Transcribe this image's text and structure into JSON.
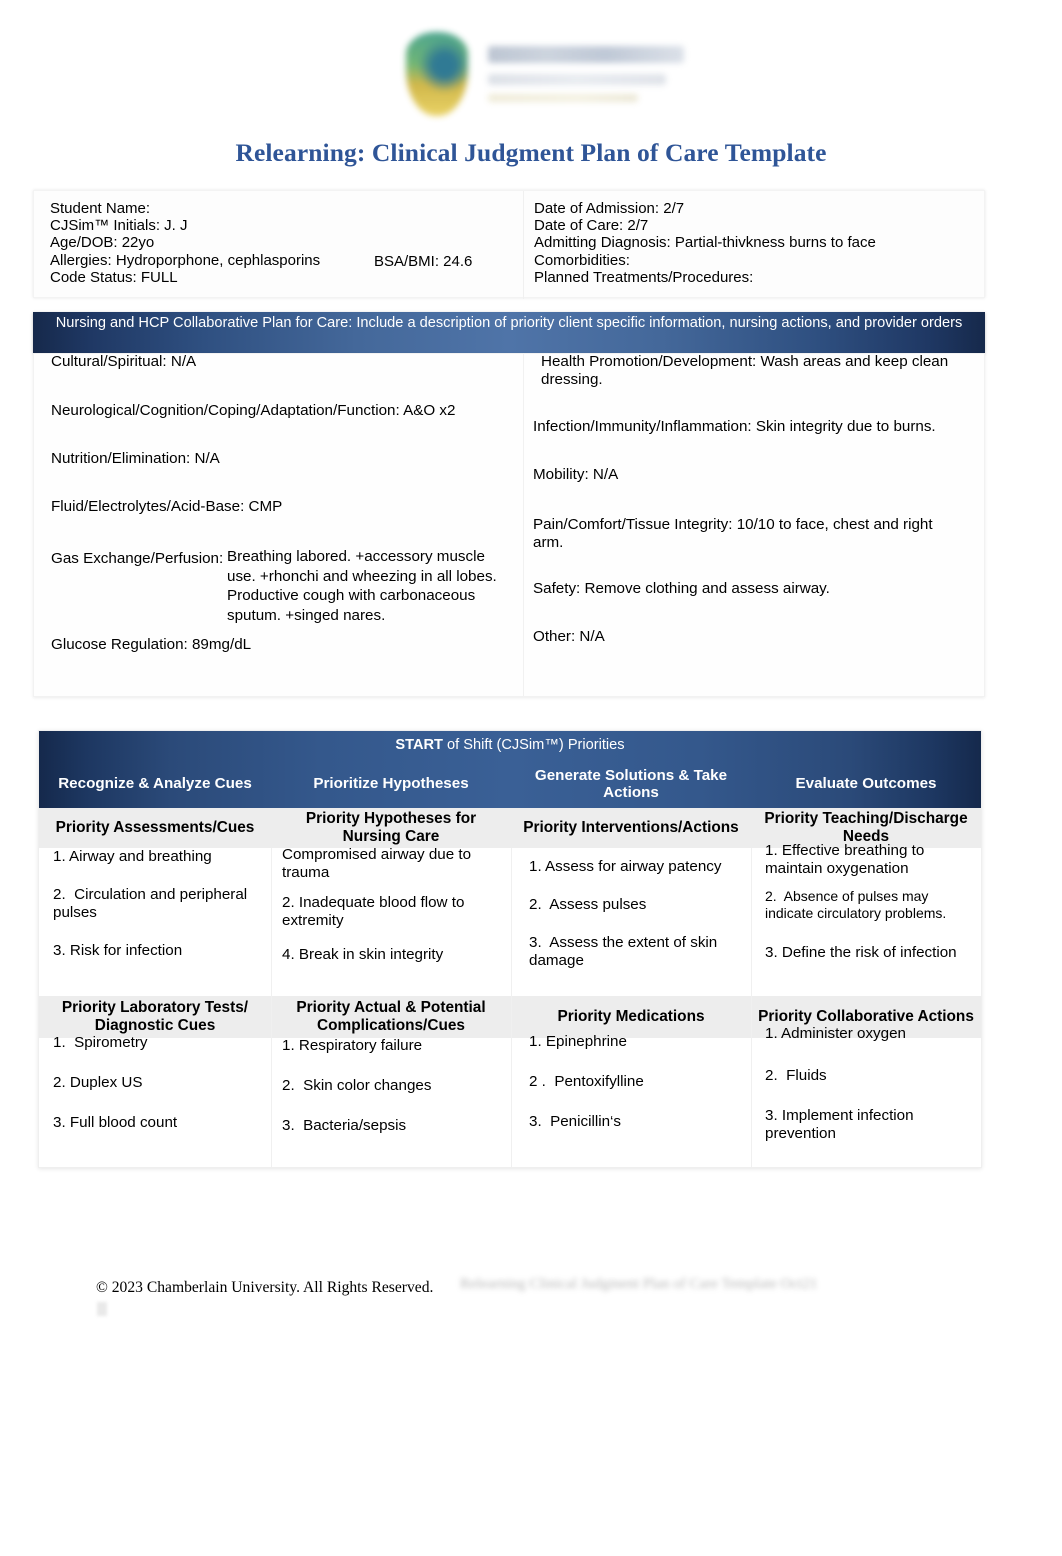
{
  "document": {
    "title": "Relearning: Clinical Judgment Plan of Care Template",
    "title_color": "#2f5597"
  },
  "logo": {
    "name": "chamberlain-university-logo"
  },
  "demographics": {
    "left": [
      "Student Name:",
      "CJSim™ Initials: J. J",
      "Age/DOB: 22yo",
      "Allergies: Hydroporphone, cephlasporins",
      "Code Status: FULL"
    ],
    "bsa_bmi": "BSA/BMI: 24.6",
    "right": [
      "Date of Admission: 2/7",
      "Date of Care: 2/7",
      "Admitting Diagnosis: Partial-thivkness burns to face",
      "Comorbidities:",
      "Planned Treatments/Procedures:"
    ]
  },
  "collab_banner": "Nursing and HCP Collaborative Plan for Care: Include a description of priority client specific information, nursing actions, and provider orders",
  "assessment": {
    "left": [
      "Cultural/Spiritual: N/A",
      "Neurological/Cognition/Coping/Adaptation/Function: A&O x2",
      "Nutrition/Elimination: N/A",
      "Fluid/Electrolytes/Acid-Base: CMP",
      "Gas Exchange/Perfusion:",
      "Breathing labored. +accessory muscle use. +rhonchi and wheezing in all lobes. Productive cough with carbonaceous sputum. +singed nares.",
      "Glucose Regulation: 89mg/dL"
    ],
    "right": [
      "Health Promotion/Development: Wash areas and keep clean dressing.",
      "Infection/Immunity/Inflammation: Skin integrity due to burns.",
      "Mobility: N/A",
      "Pain/Comfort/Tissue Integrity: 10/10 to face, chest and right arm.",
      "Safety: Remove clothing and assess airway.",
      "Other: N/A"
    ]
  },
  "priorities": {
    "title_strong": "START",
    "title_rest": " of Shift (CJSim™) Priorities",
    "headers": [
      "Recognize & Analyze Cues",
      "Prioritize Hypotheses",
      "Generate Solutions & Take Actions",
      "Evaluate Outcomes"
    ],
    "subheaders_row1": [
      "Priority Assessments/Cues",
      "Priority Hypotheses for Nursing Care",
      "Priority Interventions/Actions",
      "Priority Teaching/Discharge Needs"
    ],
    "subheaders_row2": [
      "Priority Laboratory Tests/ Diagnostic Cues",
      "Priority Actual & Potential Complications/Cues",
      "Priority Medications",
      "Priority Collaborative Actions"
    ],
    "row1": {
      "col1": [
        "1. Airway and breathing",
        "2.  Circulation and peripheral pulses",
        "3. Risk for infection"
      ],
      "col2": [
        "Compromised airway due to trauma",
        "2. Inadequate blood flow to extremity",
        "4. Break in skin integrity"
      ],
      "col3": [
        "1. Assess for airway patency",
        "2.  Assess pulses",
        "3.  Assess the extent of skin damage"
      ],
      "col4": [
        "1. Effective breathing to maintain oxygenation",
        "2.  Absence of pulses may indicate circulatory problems.",
        "3. Define the risk of infection"
      ]
    },
    "row2": {
      "col1": [
        "1.  Spirometry",
        "2. Duplex US",
        "3. Full blood count"
      ],
      "col2": [
        "1. Respiratory failure",
        "2.  Skin color changes",
        "3.  Bacteria/sepsis"
      ],
      "col3": [
        "1. Epinephrine",
        "2 .  Pentoxifylline",
        "3.  Penicillin‘s"
      ],
      "col4": [
        "1. Administer oxygen",
        "2.  Fluids",
        "3. Implement infection prevention"
      ]
    }
  },
  "footer": {
    "copyright": "© 2023 Chamberlain University. All Rights Reserved.",
    "watermark": "Relearning Clinical Judgment Plan of Care Template Oct21"
  }
}
